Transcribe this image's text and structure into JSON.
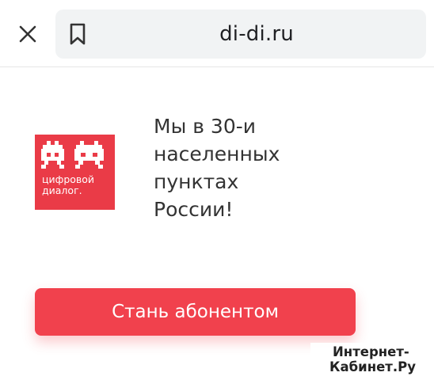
{
  "browser": {
    "url": "di-di.ru",
    "icons": {
      "close": "close-icon",
      "bookmark": "bookmark-icon"
    }
  },
  "logo": {
    "line1": "цифровой",
    "line2": "диалог.",
    "color": "#ea3b47"
  },
  "headline": {
    "lines": [
      "Мы в 30-и",
      "населенных",
      "пунктах",
      "России!"
    ]
  },
  "cta": {
    "label": "Стань абонентом",
    "color": "#f1414d"
  },
  "watermark": {
    "line1": "Интернет-",
    "line2": "Кабинет.Ру"
  }
}
